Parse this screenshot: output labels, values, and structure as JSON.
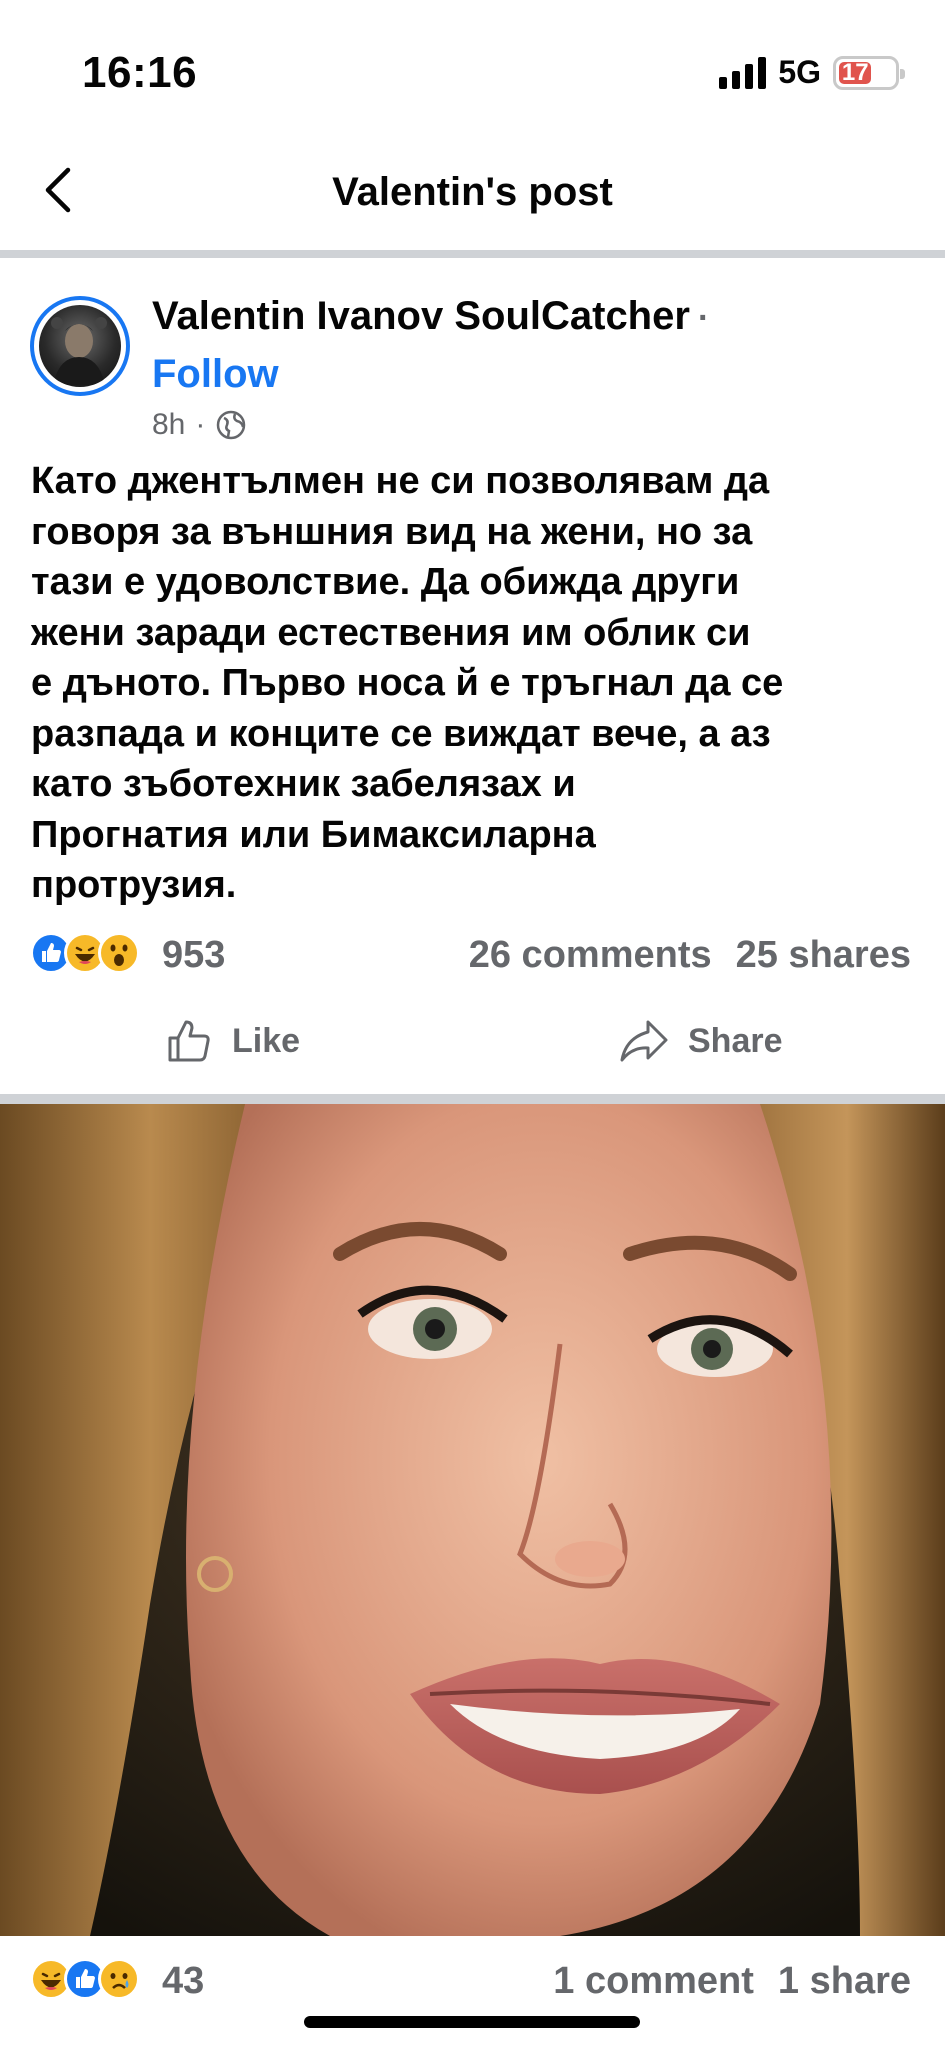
{
  "status_bar": {
    "time": "16:16",
    "network": "5G",
    "battery": "17",
    "battery_level_percent": 17,
    "battery_color": "#e0544d"
  },
  "nav": {
    "title": "Valentin's post",
    "back_icon": "chevron-left-icon"
  },
  "post": {
    "author": "Valentin Ivanov SoulCatcher",
    "separator": "·",
    "follow_label": "Follow",
    "time": "8h",
    "meta_separator": "·",
    "audience_icon": "globe-icon",
    "text": "Като джентълмен не си позволявам да\nговоря за външния вид на жени, но за\nтази е удоволствие. Да обижда други\nжени заради естествения им облик си\nе дъното. Първо носа й е тръгнал да се\nразпада и конците се виждат вече, а аз\nкато зъботехник забелязах и\nПрогнатия или Бимаксиларна\nпротрузия.",
    "reactions": [
      "like",
      "haha",
      "wow"
    ],
    "reaction_count": "953",
    "comments": "26 comments",
    "shares": "25 shares",
    "like_label": "Like",
    "share_label": "Share",
    "accent_color": "#1877f2"
  },
  "image": {
    "subject": "close-up photo of a woman with long light-brown hair, smiling"
  },
  "next_post": {
    "reactions": [
      "haha",
      "like",
      "sad"
    ],
    "reaction_count": "43",
    "comments": "1 comment",
    "shares": "1 share"
  }
}
